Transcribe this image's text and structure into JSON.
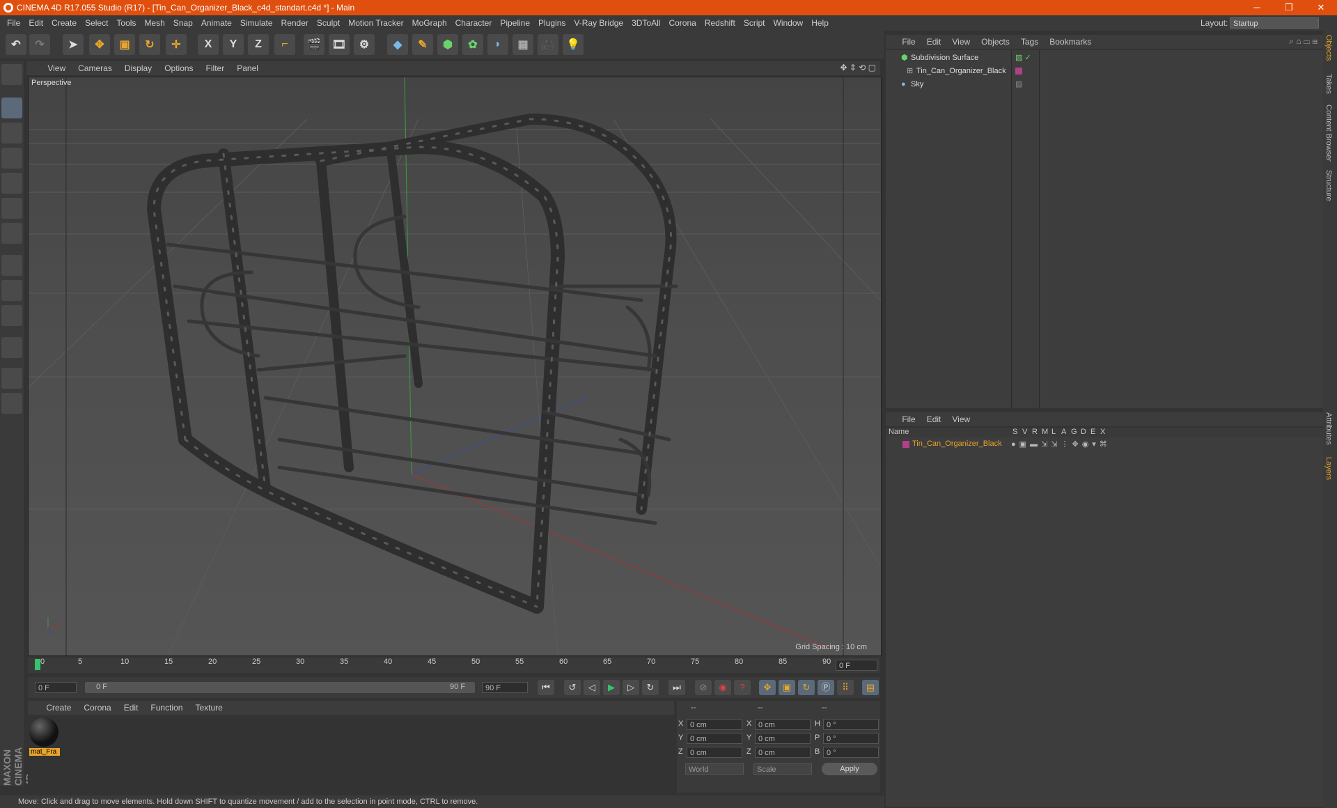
{
  "window": {
    "title": "CINEMA 4D R17.055 Studio (R17) - [Tin_Can_Organizer_Black_c4d_standart.c4d *] - Main",
    "minimize": "─",
    "maximize": "❐",
    "close": "✕"
  },
  "menubar": {
    "items": [
      "File",
      "Edit",
      "Create",
      "Select",
      "Tools",
      "Mesh",
      "Snap",
      "Animate",
      "Simulate",
      "Render",
      "Sculpt",
      "Motion Tracker",
      "MoGraph",
      "Character",
      "Pipeline",
      "Plugins",
      "V-Ray Bridge",
      "3DToAll",
      "Corona",
      "Redshift",
      "Script",
      "Window",
      "Help"
    ],
    "layout_label": "Layout:",
    "layout_value": "Startup"
  },
  "toolbar": {
    "x": "X",
    "y": "Y",
    "z": "Z"
  },
  "viewport": {
    "menu": [
      "View",
      "Cameras",
      "Display",
      "Options",
      "Filter",
      "Panel"
    ],
    "label": "Perspective",
    "grid_spacing": "Grid Spacing : 10 cm"
  },
  "timeline": {
    "ticks": [
      "0",
      "5",
      "10",
      "15",
      "20",
      "25",
      "30",
      "35",
      "40",
      "45",
      "50",
      "55",
      "60",
      "65",
      "70",
      "75",
      "80",
      "85",
      "90"
    ],
    "end_field": "0 F",
    "start_field": "0 F",
    "slider_start": "0 F",
    "slider_end": "90 F",
    "max_field": "90 F"
  },
  "material_manager": {
    "menu": [
      "Create",
      "Corona",
      "Edit",
      "Function",
      "Texture"
    ],
    "material_name": "mat_Fra"
  },
  "coordinates": {
    "headers": [
      "--",
      "--",
      "--"
    ],
    "rows": [
      {
        "a": "X",
        "v1": "0 cm",
        "b": "X",
        "v2": "0 cm",
        "c": "H",
        "v3": "0 °"
      },
      {
        "a": "Y",
        "v1": "0 cm",
        "b": "Y",
        "v2": "0 cm",
        "c": "P",
        "v3": "0 °"
      },
      {
        "a": "Z",
        "v1": "0 cm",
        "b": "Z",
        "v2": "0 cm",
        "c": "B",
        "v3": "0 °"
      }
    ],
    "world": "World",
    "scale": "Scale",
    "apply": "Apply"
  },
  "object_manager": {
    "menu": [
      "File",
      "Edit",
      "View",
      "Objects",
      "Tags",
      "Bookmarks"
    ],
    "objects": [
      "Subdivision Surface",
      "Tin_Can_Organizer_Black",
      "Sky"
    ]
  },
  "layer_manager": {
    "menu": [
      "File",
      "Edit",
      "View"
    ],
    "name_header": "Name",
    "columns": [
      "S",
      "V",
      "R",
      "M",
      "L",
      "A",
      "G",
      "D",
      "E",
      "X"
    ],
    "layer": "Tin_Can_Organizer_Black"
  },
  "right_tabs": [
    "Objects",
    "Takes",
    "Content Browser",
    "Structure",
    "Attributes",
    "Layers"
  ],
  "status": "Move: Click and drag to move elements. Hold down SHIFT to quantize movement / add to the selection in point mode, CTRL to remove.",
  "brand": "MAXON CINEMA 4D",
  "colors": {
    "accent": "#e04f0e",
    "layer_color": "#b0408a",
    "selected_text": "#e9a52b"
  }
}
